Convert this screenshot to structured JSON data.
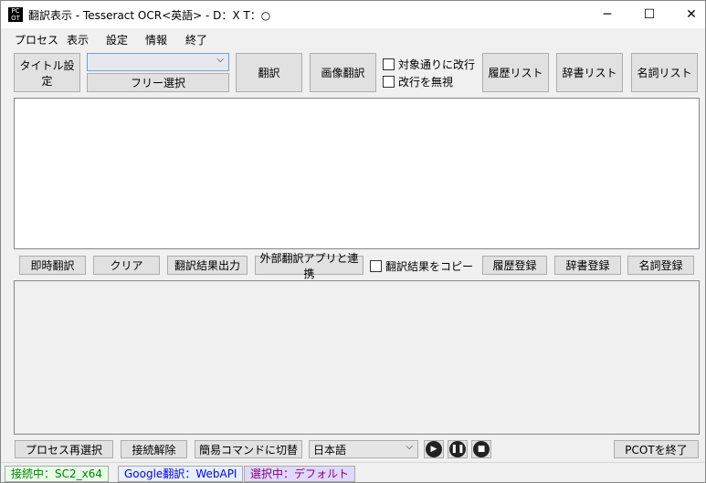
{
  "window": {
    "title": "翻訳表示 - Tesseract OCR<英語> - D：X T：○",
    "minimize": "─",
    "maximize": "☐",
    "close": "✕"
  },
  "menu": [
    "プロセス",
    "表示",
    "設定",
    "情報",
    "終了"
  ],
  "toolbar": {
    "title_setting": "タイトル設定",
    "combo_value": "",
    "free_select": "フリー選択",
    "translate": "翻訳",
    "image_translate": "画像翻訳",
    "chk_newline_target": "対象通りに改行",
    "chk_ignore_newline": "改行を無視",
    "history_list": "履歴リスト",
    "dict_list": "辞書リスト",
    "name_list": "名詞リスト"
  },
  "middle": {
    "instant": "即時翻訳",
    "clear": "クリア",
    "output": "翻訳結果出力",
    "external": "外部翻訳アプリと連携",
    "chk_copy": "翻訳結果をコピー",
    "history_reg": "履歴登録",
    "dict_reg": "辞書登録",
    "name_reg": "名詞登録"
  },
  "bottom": {
    "reselect": "プロセス再選択",
    "disconnect": "接続解除",
    "simple_cmd": "簡易コマンドに切替",
    "language": "日本語",
    "quit": "PCOTを終了"
  },
  "status": {
    "connection": "接続中：SC2_x64",
    "engine": "Google翻訳：WebAPI",
    "selection": "選択中：デフォルト"
  },
  "colors": {
    "conn_bg": "#e6ffe6",
    "conn_fg": "#008000",
    "engine_bg": "#e6f0ff",
    "engine_fg": "#0000ff",
    "sel_bg": "#e0d8ff",
    "sel_fg": "#800080"
  }
}
